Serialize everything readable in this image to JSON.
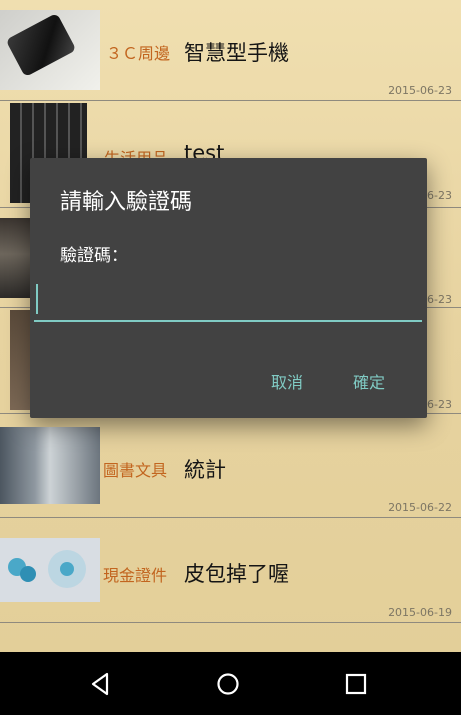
{
  "items": [
    {
      "category": "３Ｃ周邊",
      "title": "智慧型手機",
      "date": "2015-06-23"
    },
    {
      "category": "生活用品",
      "title": "test",
      "date": "2015-06-23"
    },
    {
      "category": "",
      "title": "",
      "date": "2015-06-23"
    },
    {
      "category": "",
      "title": "",
      "date": "2015-06-23"
    },
    {
      "category": "圖書文具",
      "title": "統計",
      "date": "2015-06-22"
    },
    {
      "category": "現金證件",
      "title": "皮包掉了喔",
      "date": "2015-06-19"
    }
  ],
  "dialog": {
    "title": "請輸入驗證碼",
    "label": "驗證碼：",
    "input_value": "",
    "cancel_label": "取消",
    "confirm_label": "確定"
  },
  "navbar": {
    "back": "back-icon",
    "home": "home-icon",
    "recents": "recents-icon"
  },
  "colors": {
    "accent": "#80cbc4",
    "dialog_bg": "#424242",
    "category": "#c2651f"
  }
}
